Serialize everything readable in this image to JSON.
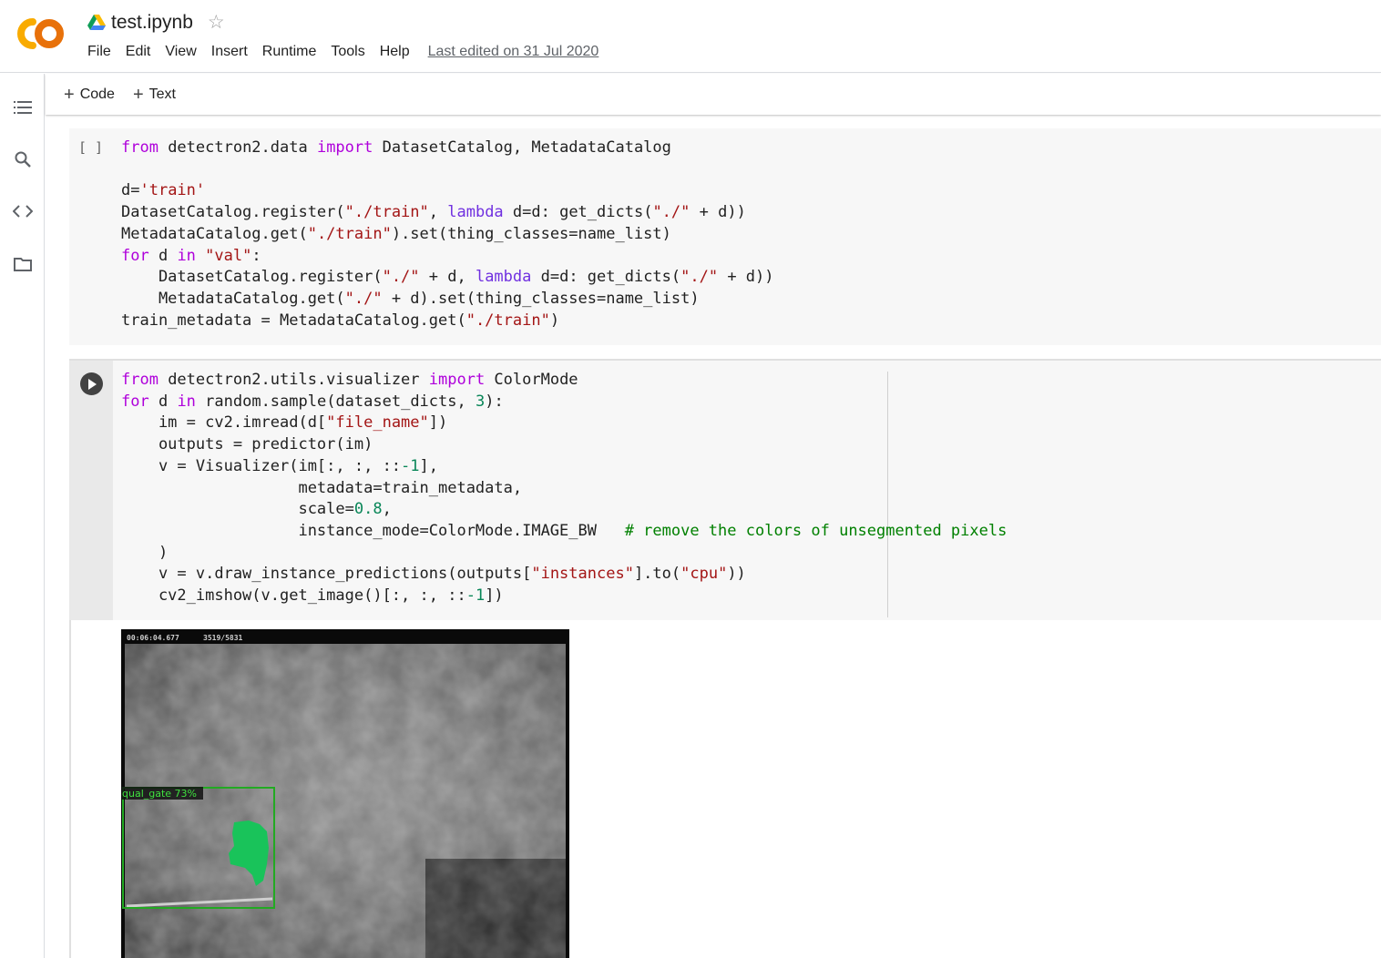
{
  "header": {
    "title": "test.ipynb",
    "menu": [
      "File",
      "Edit",
      "View",
      "Insert",
      "Runtime",
      "Tools",
      "Help"
    ],
    "last_edited": "Last edited on 31 Jul 2020"
  },
  "toolbar": {
    "code_label": "Code",
    "text_label": "Text"
  },
  "rail": {
    "icons": [
      "table-of-contents-icon",
      "search-icon",
      "code-snippets-icon",
      "files-icon"
    ]
  },
  "cells": [
    {
      "exec_count": "[ ]",
      "lines": [
        "from detectron2.data import DatasetCatalog, MetadataCatalog",
        "",
        "d='train'",
        "DatasetCatalog.register(\"./train\", lambda d=d: get_dicts(\"./\" + d))",
        "MetadataCatalog.get(\"./train\").set(thing_classes=name_list)",
        "for d in \"val\":",
        "    DatasetCatalog.register(\"./\" + d, lambda d=d: get_dicts(\"./\" + d))",
        "    MetadataCatalog.get(\"./\" + d).set(thing_classes=name_list)",
        "train_metadata = MetadataCatalog.get(\"./train\")"
      ]
    },
    {
      "lines": [
        "from detectron2.utils.visualizer import ColorMode",
        "for d in random.sample(dataset_dicts, 3):",
        "    im = cv2.imread(d[\"file_name\"])",
        "    outputs = predictor(im)",
        "    v = Visualizer(im[:, :, ::-1],",
        "                   metadata=train_metadata,",
        "                   scale=0.8,",
        "                   instance_mode=ColorMode.IMAGE_BW   # remove the colors of unsegmented pixels",
        "    )",
        "    v = v.draw_instance_predictions(outputs[\"instances\"].to(\"cpu\"))",
        "    cv2_imshow(v.get_image()[:, :, ::-1])"
      ]
    }
  ],
  "output": {
    "timestamp": "00:06:04.677",
    "frame": "3519/5831",
    "detection_label": "qual_gate 73%",
    "detection_color": "#22aa22",
    "mask_color": "#19c35a"
  },
  "colors": {
    "keyword": "#af00db",
    "string": "#a31515",
    "number": "#098658",
    "comment": "#008000"
  }
}
